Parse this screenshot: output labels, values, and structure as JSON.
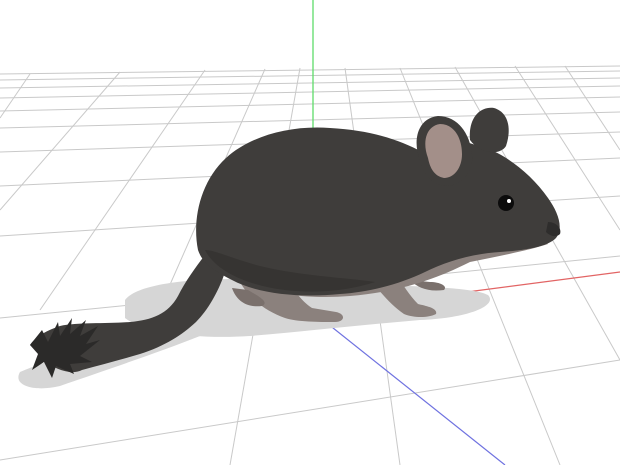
{
  "viewport": {
    "background": "#ffffff",
    "grid_color": "#c9c9c9",
    "axis_colors": {
      "y_axis": "#5fdc6a",
      "x_axis": "#e26464",
      "z_axis": "#6f72e0"
    }
  },
  "model": {
    "body_color": "#3f3d3b",
    "underside_color": "#8b817d",
    "inner_ear_color": "#a38f89",
    "eye_color": "#0c0c0c",
    "shadow_color": "#d6d6d6"
  }
}
